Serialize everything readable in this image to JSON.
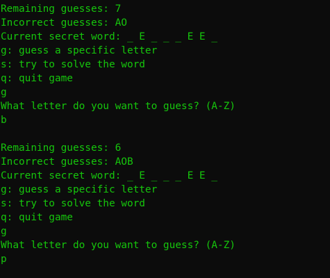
{
  "terminal": {
    "text_color": "#16c60c",
    "background_color": "#0c0c0c",
    "lines": [
      "Remaining guesses: 7",
      "Incorrect guesses: AO",
      "Current secret word: _ E _ _ _ E E _",
      "g: guess a specific letter",
      "s: try to solve the word",
      "q: quit game",
      "g",
      "What letter do you want to guess? (A-Z)",
      "b",
      "",
      "Remaining guesses: 6",
      "Incorrect guesses: AOB",
      "Current secret word: _ E _ _ _ E E _",
      "g: guess a specific letter",
      "s: try to solve the word",
      "q: quit game",
      "g",
      "What letter do you want to guess? (A-Z)",
      "p"
    ]
  }
}
